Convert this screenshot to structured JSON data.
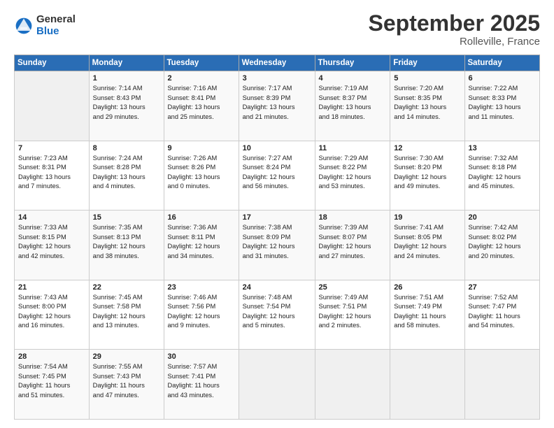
{
  "header": {
    "logo_general": "General",
    "logo_blue": "Blue",
    "month": "September 2025",
    "location": "Rolleville, France"
  },
  "days_of_week": [
    "Sunday",
    "Monday",
    "Tuesday",
    "Wednesday",
    "Thursday",
    "Friday",
    "Saturday"
  ],
  "weeks": [
    [
      {
        "day": "",
        "info": ""
      },
      {
        "day": "1",
        "info": "Sunrise: 7:14 AM\nSunset: 8:43 PM\nDaylight: 13 hours\nand 29 minutes."
      },
      {
        "day": "2",
        "info": "Sunrise: 7:16 AM\nSunset: 8:41 PM\nDaylight: 13 hours\nand 25 minutes."
      },
      {
        "day": "3",
        "info": "Sunrise: 7:17 AM\nSunset: 8:39 PM\nDaylight: 13 hours\nand 21 minutes."
      },
      {
        "day": "4",
        "info": "Sunrise: 7:19 AM\nSunset: 8:37 PM\nDaylight: 13 hours\nand 18 minutes."
      },
      {
        "day": "5",
        "info": "Sunrise: 7:20 AM\nSunset: 8:35 PM\nDaylight: 13 hours\nand 14 minutes."
      },
      {
        "day": "6",
        "info": "Sunrise: 7:22 AM\nSunset: 8:33 PM\nDaylight: 13 hours\nand 11 minutes."
      }
    ],
    [
      {
        "day": "7",
        "info": "Sunrise: 7:23 AM\nSunset: 8:31 PM\nDaylight: 13 hours\nand 7 minutes."
      },
      {
        "day": "8",
        "info": "Sunrise: 7:24 AM\nSunset: 8:28 PM\nDaylight: 13 hours\nand 4 minutes."
      },
      {
        "day": "9",
        "info": "Sunrise: 7:26 AM\nSunset: 8:26 PM\nDaylight: 13 hours\nand 0 minutes."
      },
      {
        "day": "10",
        "info": "Sunrise: 7:27 AM\nSunset: 8:24 PM\nDaylight: 12 hours\nand 56 minutes."
      },
      {
        "day": "11",
        "info": "Sunrise: 7:29 AM\nSunset: 8:22 PM\nDaylight: 12 hours\nand 53 minutes."
      },
      {
        "day": "12",
        "info": "Sunrise: 7:30 AM\nSunset: 8:20 PM\nDaylight: 12 hours\nand 49 minutes."
      },
      {
        "day": "13",
        "info": "Sunrise: 7:32 AM\nSunset: 8:18 PM\nDaylight: 12 hours\nand 45 minutes."
      }
    ],
    [
      {
        "day": "14",
        "info": "Sunrise: 7:33 AM\nSunset: 8:15 PM\nDaylight: 12 hours\nand 42 minutes."
      },
      {
        "day": "15",
        "info": "Sunrise: 7:35 AM\nSunset: 8:13 PM\nDaylight: 12 hours\nand 38 minutes."
      },
      {
        "day": "16",
        "info": "Sunrise: 7:36 AM\nSunset: 8:11 PM\nDaylight: 12 hours\nand 34 minutes."
      },
      {
        "day": "17",
        "info": "Sunrise: 7:38 AM\nSunset: 8:09 PM\nDaylight: 12 hours\nand 31 minutes."
      },
      {
        "day": "18",
        "info": "Sunrise: 7:39 AM\nSunset: 8:07 PM\nDaylight: 12 hours\nand 27 minutes."
      },
      {
        "day": "19",
        "info": "Sunrise: 7:41 AM\nSunset: 8:05 PM\nDaylight: 12 hours\nand 24 minutes."
      },
      {
        "day": "20",
        "info": "Sunrise: 7:42 AM\nSunset: 8:02 PM\nDaylight: 12 hours\nand 20 minutes."
      }
    ],
    [
      {
        "day": "21",
        "info": "Sunrise: 7:43 AM\nSunset: 8:00 PM\nDaylight: 12 hours\nand 16 minutes."
      },
      {
        "day": "22",
        "info": "Sunrise: 7:45 AM\nSunset: 7:58 PM\nDaylight: 12 hours\nand 13 minutes."
      },
      {
        "day": "23",
        "info": "Sunrise: 7:46 AM\nSunset: 7:56 PM\nDaylight: 12 hours\nand 9 minutes."
      },
      {
        "day": "24",
        "info": "Sunrise: 7:48 AM\nSunset: 7:54 PM\nDaylight: 12 hours\nand 5 minutes."
      },
      {
        "day": "25",
        "info": "Sunrise: 7:49 AM\nSunset: 7:51 PM\nDaylight: 12 hours\nand 2 minutes."
      },
      {
        "day": "26",
        "info": "Sunrise: 7:51 AM\nSunset: 7:49 PM\nDaylight: 11 hours\nand 58 minutes."
      },
      {
        "day": "27",
        "info": "Sunrise: 7:52 AM\nSunset: 7:47 PM\nDaylight: 11 hours\nand 54 minutes."
      }
    ],
    [
      {
        "day": "28",
        "info": "Sunrise: 7:54 AM\nSunset: 7:45 PM\nDaylight: 11 hours\nand 51 minutes."
      },
      {
        "day": "29",
        "info": "Sunrise: 7:55 AM\nSunset: 7:43 PM\nDaylight: 11 hours\nand 47 minutes."
      },
      {
        "day": "30",
        "info": "Sunrise: 7:57 AM\nSunset: 7:41 PM\nDaylight: 11 hours\nand 43 minutes."
      },
      {
        "day": "",
        "info": ""
      },
      {
        "day": "",
        "info": ""
      },
      {
        "day": "",
        "info": ""
      },
      {
        "day": "",
        "info": ""
      }
    ]
  ]
}
